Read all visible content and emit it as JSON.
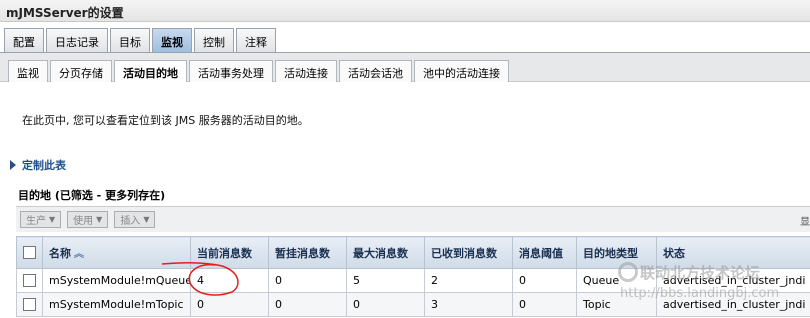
{
  "window": {
    "title": "mJMSServer的设置"
  },
  "main_tabs": [
    {
      "label": "配置"
    },
    {
      "label": "日志记录"
    },
    {
      "label": "目标"
    },
    {
      "label": "监视"
    },
    {
      "label": "控制"
    },
    {
      "label": "注释"
    }
  ],
  "sub_tabs": [
    {
      "label": "监视"
    },
    {
      "label": "分页存储"
    },
    {
      "label": "活动目的地"
    },
    {
      "label": "活动事务处理"
    },
    {
      "label": "活动连接"
    },
    {
      "label": "活动会话池"
    },
    {
      "label": "池中的活动连接"
    }
  ],
  "intro_text": "在此页中, 您可以查看定位到该 JMS 服务器的活动目的地。",
  "customize_label": "定制此表",
  "table_title": "目的地 (已筛选 - 更多列存在)",
  "toolbar": {
    "produce_label": "生产",
    "consume_label": "使用",
    "insert_label": "插入",
    "pager_text": "显"
  },
  "table": {
    "columns": [
      "名称",
      "当前消息数",
      "暂挂消息数",
      "最大消息数",
      "已收到消息数",
      "消息阈值",
      "目的地类型",
      "状态"
    ],
    "rows": [
      [
        "mSystemModule!mQueue",
        "4",
        "0",
        "5",
        "2",
        "0",
        "Queue",
        "advertised_in_cluster_jndi"
      ],
      [
        "mSystemModule!mTopic",
        "0",
        "0",
        "0",
        "3",
        "0",
        "Topic",
        "advertised_in_cluster_jndi"
      ]
    ]
  },
  "watermark": {
    "line1": "联动北方技术论坛",
    "line2": "http://bbs.landingbj.com"
  },
  "colors": {
    "active_tab": "#9fbfe0",
    "link": "#1f4e8c",
    "annotation": "#e0201e"
  }
}
